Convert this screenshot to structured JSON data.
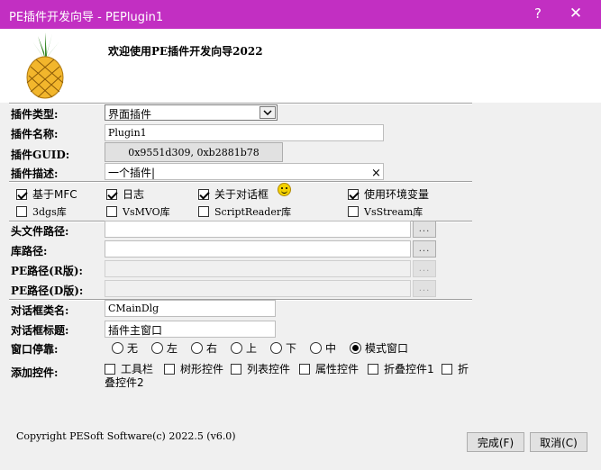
{
  "window": {
    "title": "PE插件开发向导 - PEPlugin1",
    "help_glyph": "?",
    "close_glyph": "✕"
  },
  "header": {
    "welcome": "欢迎使用PE插件开发向导2022"
  },
  "form": {
    "plugin_type": {
      "label": "插件类型:",
      "value": "界面插件"
    },
    "plugin_name": {
      "label": "插件名称:",
      "value": "Plugin1"
    },
    "plugin_guid": {
      "label": "插件GUID:",
      "value": "0x9551d309, 0xb2881b78"
    },
    "plugin_desc": {
      "label": "插件描述:",
      "value": "一个插件|",
      "clear_glyph": "×"
    }
  },
  "options": [
    {
      "label": "基于MFC",
      "checked": true
    },
    {
      "label": "日志",
      "checked": true
    },
    {
      "label": "关于对话框",
      "checked": true
    },
    {
      "label": "使用环境变量",
      "checked": true
    },
    {
      "label": "3dgs库",
      "checked": false
    },
    {
      "label": "VsMVO库",
      "checked": false
    },
    {
      "label": "ScriptReader库",
      "checked": false
    },
    {
      "label": "VsStream库",
      "checked": false
    }
  ],
  "paths": {
    "header_path": {
      "label": "头文件路径:",
      "value": ""
    },
    "lib_path": {
      "label": "库路径:",
      "value": ""
    },
    "pe_release": {
      "label": "PE路径(R版):",
      "value": ""
    },
    "pe_debug": {
      "label": "PE路径(D版):",
      "value": ""
    },
    "browse_label": "..."
  },
  "dialog": {
    "class_name": {
      "label": "对话框类名:",
      "value": "CMainDlg"
    },
    "title": {
      "label": "对话框标题:",
      "value": "插件主窗口"
    },
    "dock": {
      "label": "窗口停靠:",
      "options": [
        "无",
        "左",
        "右",
        "上",
        "下",
        "中",
        "模式窗口"
      ],
      "selected": "模式窗口"
    },
    "controls": {
      "label": "添加控件:",
      "items": [
        "工具栏",
        "树形控件",
        "列表控件",
        "属性控件",
        "折叠控件1",
        "折"
      ],
      "wrap_line": "叠控件2"
    }
  },
  "footer": {
    "copyright": "Copyright PESoft Software(c) 2022.5 (v6.0)",
    "finish": "完成(F)",
    "cancel": "取消(C)"
  },
  "colors": {
    "titlebar": "#c22fc2",
    "pineapple_body": "#f2b62c",
    "pineapple_leaves": "#3a8a2a"
  },
  "icons": {
    "logo": "pineapple-icon",
    "smiley": "smiley-icon",
    "dropdown": "chevron-down-icon"
  }
}
